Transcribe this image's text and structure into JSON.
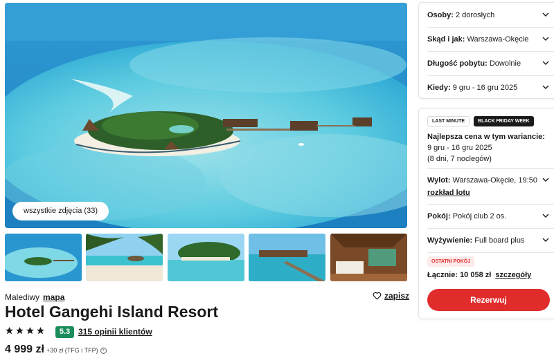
{
  "gallery": {
    "all_photos_label": "wszystkie zdjęcia (33)",
    "thumbnails": [
      "island-aerial",
      "beach-palms",
      "beach-huts",
      "water-villas-jetty",
      "villa-interior"
    ]
  },
  "hotel": {
    "country": "Malediwy",
    "map_label": "mapa",
    "save_label": "zapisz",
    "name": "Hotel Gangehi Island Resort",
    "stars": 4,
    "score": "5.3",
    "reviews_label": "315 opinii klientów",
    "price": "4 999 zł",
    "price_extra": "+30 zł (TFG i TFP)",
    "info_icon": "ⓘ"
  },
  "search": {
    "rows": [
      {
        "label": "Osoby:",
        "value": "2 dorosłych"
      },
      {
        "label": "Skąd i jak:",
        "value": "Warszawa-Okęcie"
      },
      {
        "label": "Długość pobytu:",
        "value": "Dowolnie"
      },
      {
        "label": "Kiedy:",
        "value": "9 gru - 16 gru 2025"
      }
    ]
  },
  "offer": {
    "tag_last_minute": "LAST MINUTE",
    "tag_black_friday": "BLACK FRIDAY WEEK",
    "best_price_heading": "Najlepsza cena w tym wariancie:",
    "dates": "9 gru - 16 gru 2025",
    "duration": "(8 dni, 7 noclegów)",
    "flight_label": "Wylot:",
    "flight_value": "Warszawa-Okęcie, 19:50",
    "flight_schedule_link": "rozkład lotu",
    "room_label": "Pokój:",
    "room_value": "Pokój club 2 os.",
    "board_label": "Wyżywienie:",
    "board_value": "Full board plus",
    "last_room_badge": "OSTATNI POKÓJ",
    "total_label": "Łącznie: 10 058 zł",
    "details_link": "szczegóły",
    "reserve_label": "Rezerwuj"
  },
  "colors": {
    "primary_red": "#e12c2c",
    "score_green": "#1a8d5b",
    "ocean": "#1f8ec9"
  }
}
